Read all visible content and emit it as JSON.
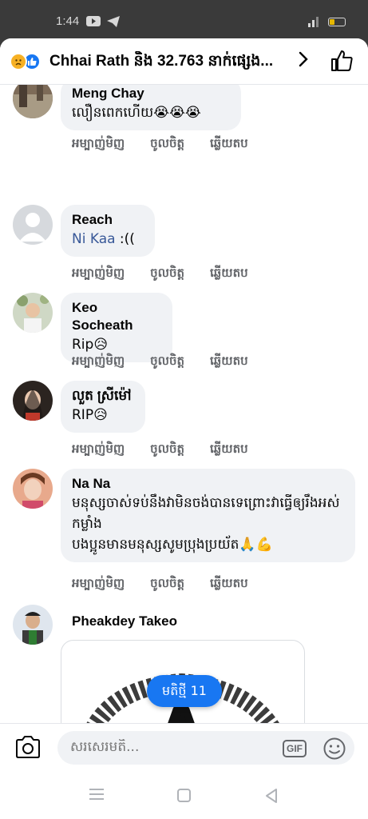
{
  "status_bar": {
    "time": "1:44"
  },
  "header": {
    "title": "Chhai Rath និង 32.763 នាក់ផ្សេង...",
    "chevron": "›",
    "reactions": [
      "sad",
      "like"
    ]
  },
  "action_labels": {
    "like": "អម្បាញ់មិញ",
    "react": "ចូលចិត្ត",
    "reply": "ឆ្លើយតប"
  },
  "comments": [
    {
      "name": "Meng Chay",
      "text": "លឿនពេកហើយ😭😭😭"
    },
    {
      "name": "Reach",
      "text_link": "Ni Kaa",
      "text_rest": " :(("
    },
    {
      "name": "Keo Socheath",
      "text": "Rip😥"
    },
    {
      "name": "លួត ស្រីម៉ៅ",
      "text": "RIP😥"
    },
    {
      "name": "Na Na",
      "text": "មនុស្សចាស់ទប់នឹងវាមិនចង់បានទេព្រោះវាធ្វើឲ្យរឹងអស់កម្លាំង\nបងប្អូនមានមនុស្សសូមប្រុងប្រយ័ត🙏💪"
    },
    {
      "name": "Pheakdey Takeo"
    }
  ],
  "new_comments_pill": "មតិថ្មី 11",
  "composer": {
    "placeholder": "សរសេរមតិ...",
    "gif_label": "GIF"
  },
  "colors": {
    "accent": "#1877f2",
    "bubble": "#f0f2f5",
    "muted": "#65676b",
    "link": "#385898"
  }
}
